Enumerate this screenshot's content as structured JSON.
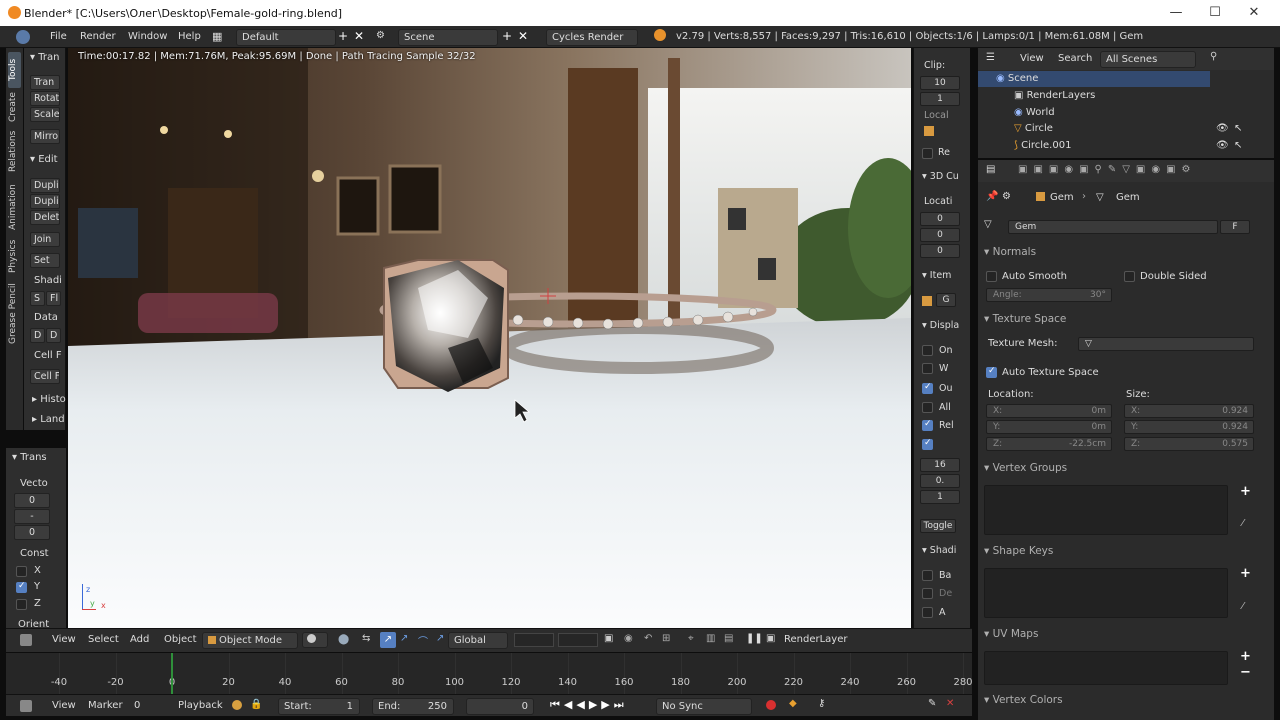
{
  "window": {
    "title": "Blender* [C:\\Users\\Олег\\Desktop\\Female-gold-ring.blend]",
    "minimize": "—",
    "maximize": "☐",
    "close": "✕"
  },
  "menubar": {
    "items": [
      "File",
      "Render",
      "Window",
      "Help"
    ],
    "layout": "Default",
    "scene": "Scene",
    "engine": "Cycles Render",
    "stats": "v2.79 | Verts:8,557 | Faces:9,297 | Tris:16,610 | Objects:1/6 | Lamps:0/1 | Mem:61.08M | Gem"
  },
  "tool_tabs": [
    "Tools",
    "Create",
    "Relations",
    "Animation",
    "Physics",
    "Grease Pencil"
  ],
  "tool_shelf": {
    "transform_header": "Tran",
    "transform_buttons": [
      "Tran",
      "Rotat",
      "Scale",
      "Mirro"
    ],
    "edit_header": "Edit",
    "edit_buttons": [
      "Dupli",
      "Dupli",
      "Delet",
      "Join",
      "Set"
    ],
    "shading": "Shadi",
    "shading_btns": [
      "S",
      "Fl"
    ],
    "data": "Data",
    "data_btns": [
      "D",
      "D"
    ],
    "cell_f1": "Cell F",
    "cell_f2": "Cell F",
    "history": "Histo",
    "land": "Land"
  },
  "op_panel": {
    "header": "Trans",
    "vector": "Vecto",
    "v1": "0",
    "v2": "-",
    "v3": "0",
    "constraint": "Const",
    "axes": [
      {
        "name": "X",
        "checked": false
      },
      {
        "name": "Y",
        "checked": true
      },
      {
        "name": "Z",
        "checked": false
      }
    ],
    "orient": "Orient"
  },
  "viewport": {
    "status": "Time:00:17.82 | Mem:71.76M, Peak:95.69M | Done | Path Tracing Sample 32/32",
    "axis_z": "z",
    "axis_y": "y",
    "axis_x": "x"
  },
  "viewport_header": {
    "view": "View",
    "select": "Select",
    "add": "Add",
    "object": "Object",
    "mode": "Object Mode",
    "orientation": "Global",
    "render_layer": "RenderLayer"
  },
  "n_panel": {
    "clip": "Clip:",
    "clip1": "10",
    "clip2": "1",
    "local": "Local",
    "re": "Re",
    "cursor": "3D Cu",
    "location": "Locati",
    "loc": [
      "0",
      "0",
      "0"
    ],
    "item": "Item",
    "g": "G",
    "display": "Displa",
    "disp": [
      {
        "label": "On",
        "checked": false
      },
      {
        "label": "W",
        "checked": false
      },
      {
        "label": "Ou",
        "checked": true
      },
      {
        "label": "All",
        "checked": false
      },
      {
        "label": "Rel",
        "checked": true
      }
    ],
    "n16": "16",
    "n0": "0.",
    "n1": "1",
    "toggle": "Toggle",
    "shading": "Shadi",
    "shad": [
      {
        "label": "Ba",
        "checked": false
      },
      {
        "label": "De",
        "checked": false
      },
      {
        "label": "A",
        "checked": false
      }
    ]
  },
  "timeline": {
    "ticks": [
      "-40",
      "-20",
      "0",
      "20",
      "40",
      "60",
      "80",
      "100",
      "120",
      "140",
      "160",
      "180",
      "200",
      "220",
      "240",
      "260",
      "280"
    ],
    "current_frame_value": 0
  },
  "timeline_header": {
    "view": "View",
    "marker": "Marker",
    "frame": "0",
    "playback": "Playback",
    "start_label": "Start:",
    "start": "1",
    "end_label": "End:",
    "end": "250",
    "sync": "No Sync"
  },
  "outliner": {
    "view": "View",
    "search": "Search",
    "scenes": "All Scenes",
    "items": [
      {
        "name": "Scene",
        "indent": 0
      },
      {
        "name": "RenderLayers",
        "indent": 1
      },
      {
        "name": "World",
        "indent": 1
      },
      {
        "name": "Circle",
        "indent": 1
      },
      {
        "name": "Circle.001",
        "indent": 1
      }
    ]
  },
  "properties": {
    "breadcrumb1": "Gem",
    "breadcrumb2": "Gem",
    "mesh_name": "Gem",
    "fake_user": "F",
    "normals": "Normals",
    "auto_smooth": "Auto Smooth",
    "double_sided": "Double Sided",
    "angle_label": "Angle:",
    "angle": "30°",
    "texture_space": "Texture Space",
    "texture_mesh": "Texture Mesh:",
    "auto_texture_space": "Auto Texture Space",
    "location": "Location:",
    "size": "Size:",
    "loc": [
      {
        "axis": "X:",
        "value": "0m"
      },
      {
        "axis": "Y:",
        "value": "0m"
      },
      {
        "axis": "Z:",
        "value": "-22.5cm"
      }
    ],
    "siz": [
      {
        "axis": "X:",
        "value": "0.924"
      },
      {
        "axis": "Y:",
        "value": "0.924"
      },
      {
        "axis": "Z:",
        "value": "0.575"
      }
    ],
    "vertex_groups": "Vertex Groups",
    "shape_keys": "Shape Keys",
    "uv_maps": "UV Maps",
    "vertex_colors": "Vertex Colors"
  }
}
